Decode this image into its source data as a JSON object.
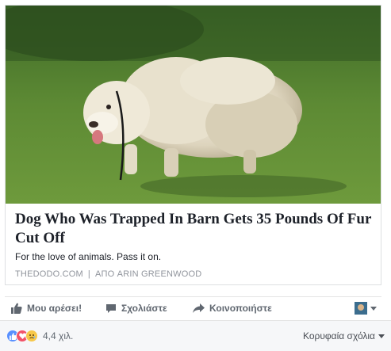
{
  "post": {
    "image_alt": "",
    "headline": "Dog Who Was Trapped In Barn Gets 35 Pounds Of Fur Cut Off",
    "description": "For the love of animals. Pass it on.",
    "source_domain": "THEDODO.COM",
    "separator": "|",
    "byline": "ΑΠΟ ARIN GREENWOOD"
  },
  "actions": {
    "like_label": "Μου αρέσει!",
    "comment_label": "Σχολιάστε",
    "share_label": "Κοινοποιήστε"
  },
  "footer": {
    "reaction_count": "4,4 χιλ.",
    "sort_label": "Κορυφαία σχόλια"
  },
  "colors": {
    "text_primary": "#1d2129",
    "text_secondary": "#606770",
    "meta": "#90949c",
    "like_blue": "#5890ff",
    "love_red": "#f25268",
    "sad_yellow": "#f7c84a"
  },
  "icons": [
    "thumbs-up-icon",
    "comment-icon",
    "share-arrow-icon",
    "avatar",
    "caret-down-icon",
    "like-reaction-icon",
    "love-reaction-icon",
    "sad-reaction-icon"
  ]
}
